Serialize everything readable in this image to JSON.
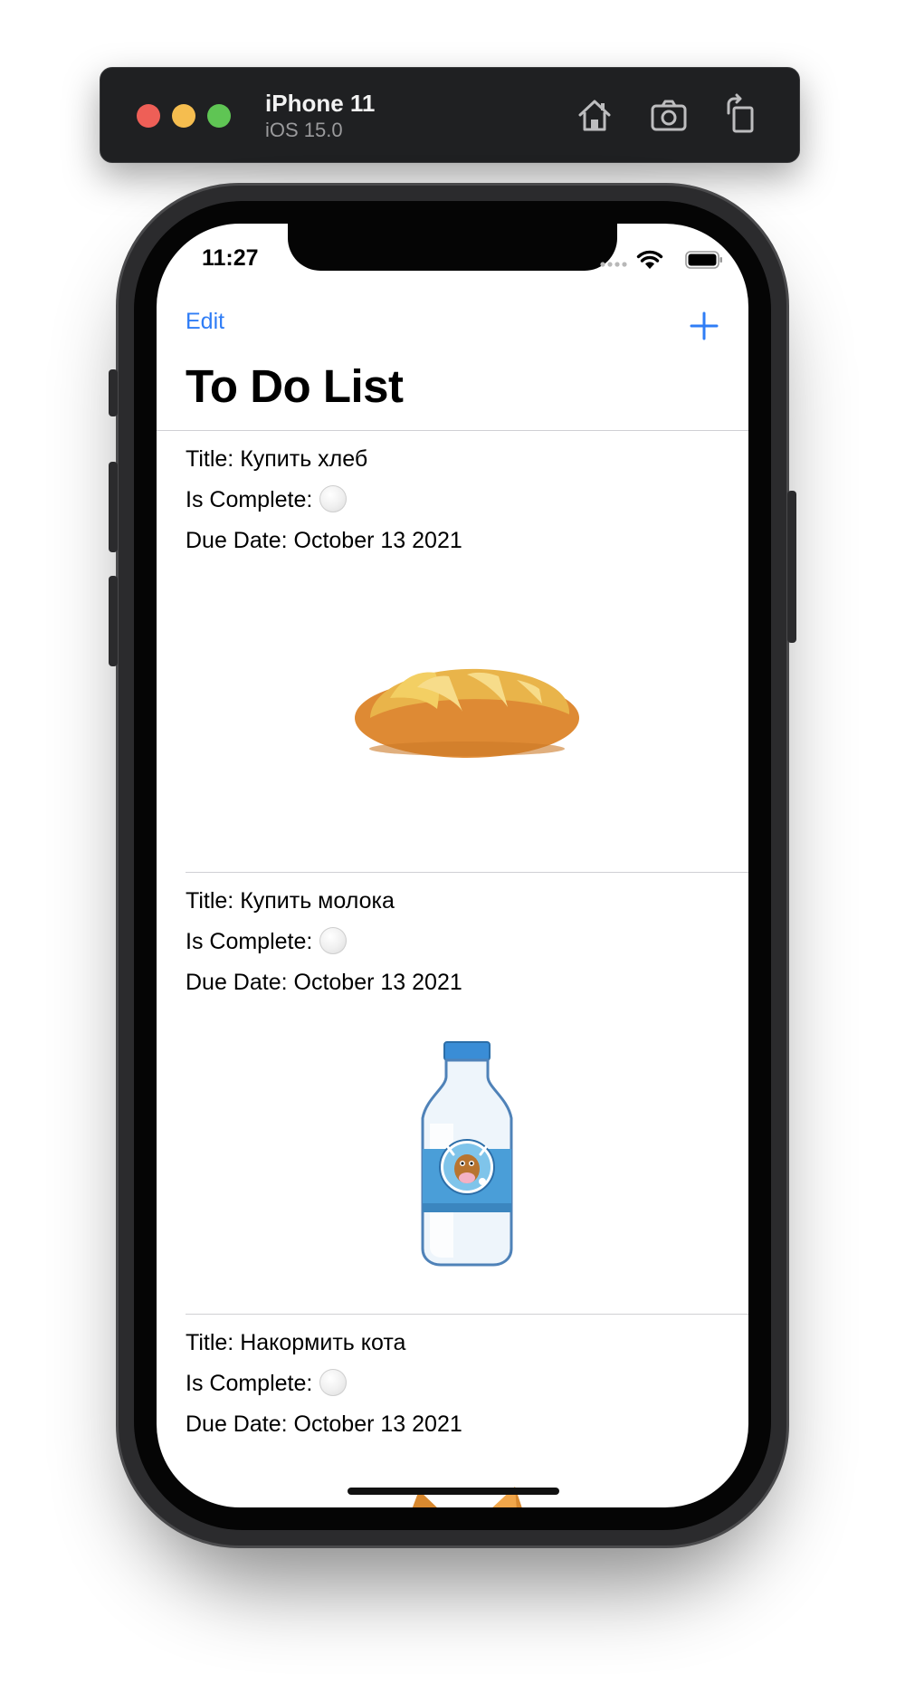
{
  "simulator": {
    "device_name": "iPhone 11",
    "os_version": "iOS 15.0",
    "icons": [
      "home-icon",
      "screenshot-icon",
      "rotate-icon"
    ]
  },
  "status_bar": {
    "time": "11:27"
  },
  "nav": {
    "edit_label": "Edit",
    "add_icon": "plus-icon",
    "title": "To Do List"
  },
  "colors": {
    "accent": "#2f7df6"
  },
  "items": [
    {
      "title_line": "Title: Купить хлеб",
      "complete_label": "Is Complete:",
      "due_line": "Due Date: October 13 2021",
      "image": "bread-image"
    },
    {
      "title_line": "Title: Купить молока",
      "complete_label": "Is Complete:",
      "due_line": "Due Date: October 13 2021",
      "image": "milk-bottle-image"
    },
    {
      "title_line": "Title: Накормить кота",
      "complete_label": "Is Complete:",
      "due_line": "Due Date: October 13 2021",
      "image": "cat-image"
    }
  ]
}
